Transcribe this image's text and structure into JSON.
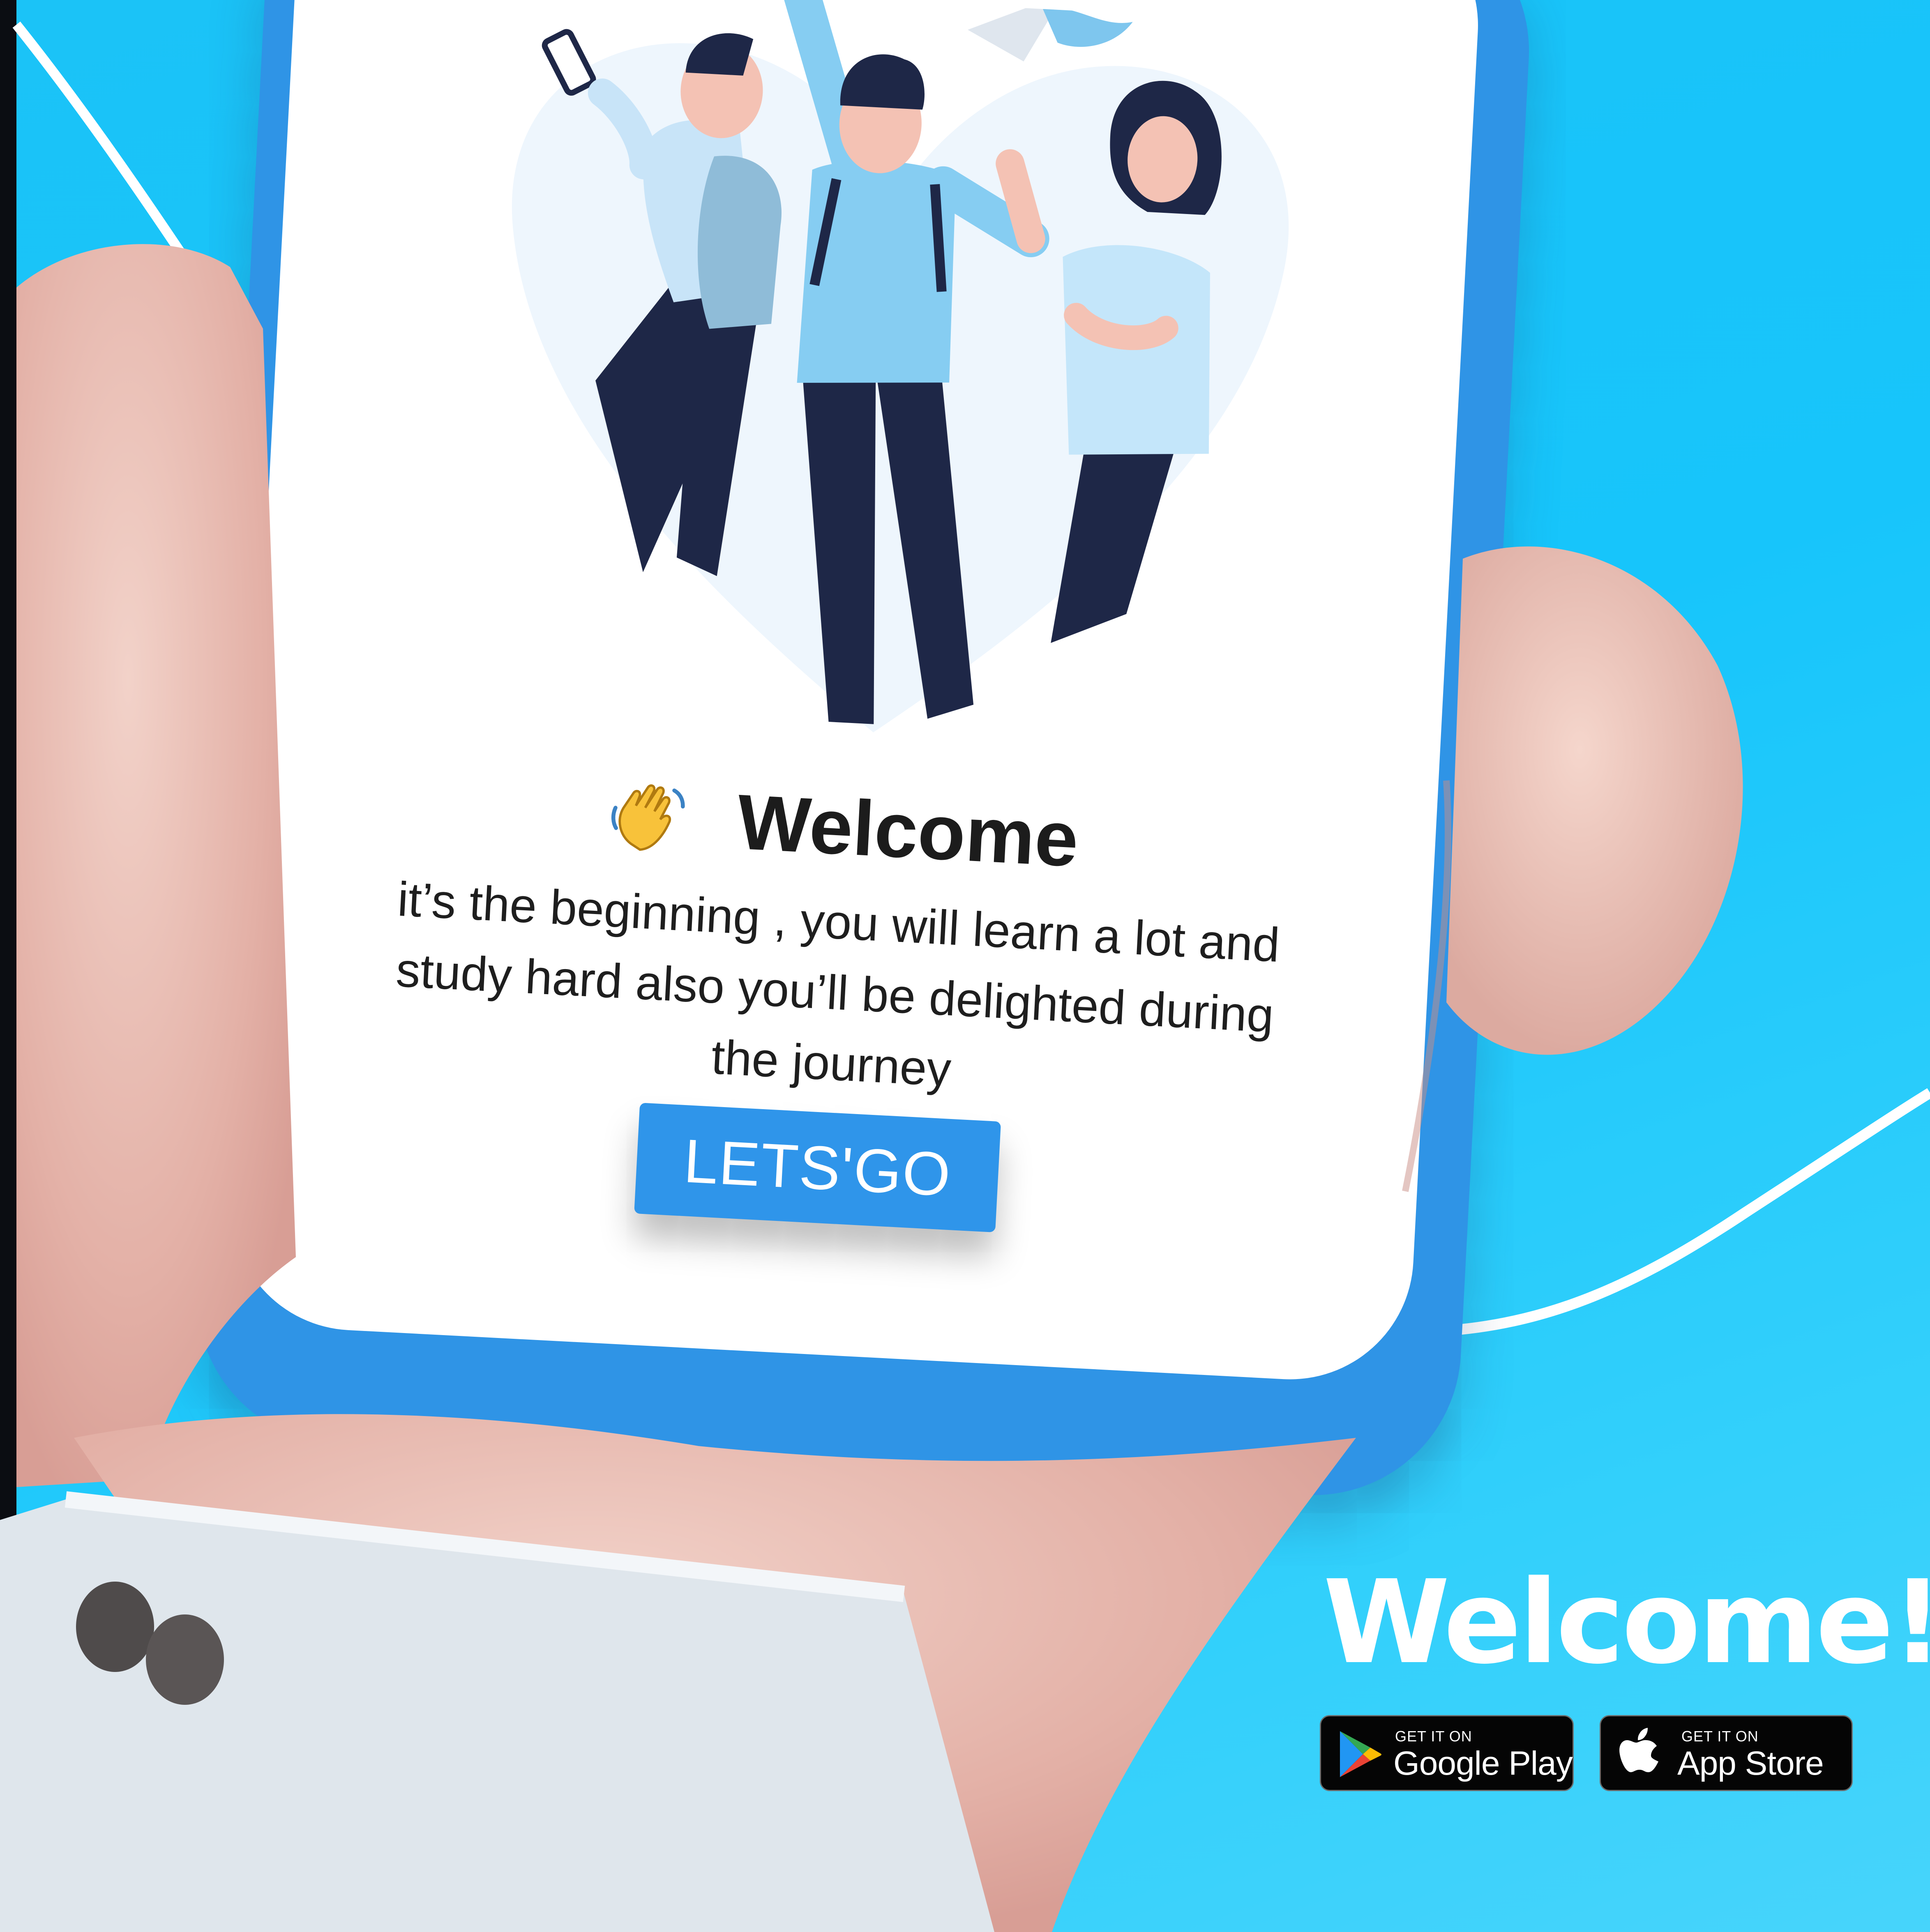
{
  "screen": {
    "title": "Welcome",
    "message_line1": "it’s the beginning , you will learn a lot and",
    "message_line2": "study hard also you’ll be delighted during",
    "message_line3": "the journey",
    "button_label": "LETS'GO"
  },
  "promo": {
    "title": "Welcome!",
    "google_play": {
      "small_text": "GET IT ON",
      "big_text": "Google Play"
    },
    "app_store": {
      "small_text": "GET IT ON",
      "big_text": "App Store"
    }
  },
  "icons": {
    "wave": "waving-hand-icon",
    "google_play": "google-play-icon",
    "apple": "apple-icon"
  },
  "colors": {
    "background": "#17c5fb",
    "phone_frame": "#2f94e6",
    "button": "#2f95ea",
    "badge": "#050505",
    "skin": "#e9b7ad",
    "sleeve": "#dfe6ec"
  }
}
